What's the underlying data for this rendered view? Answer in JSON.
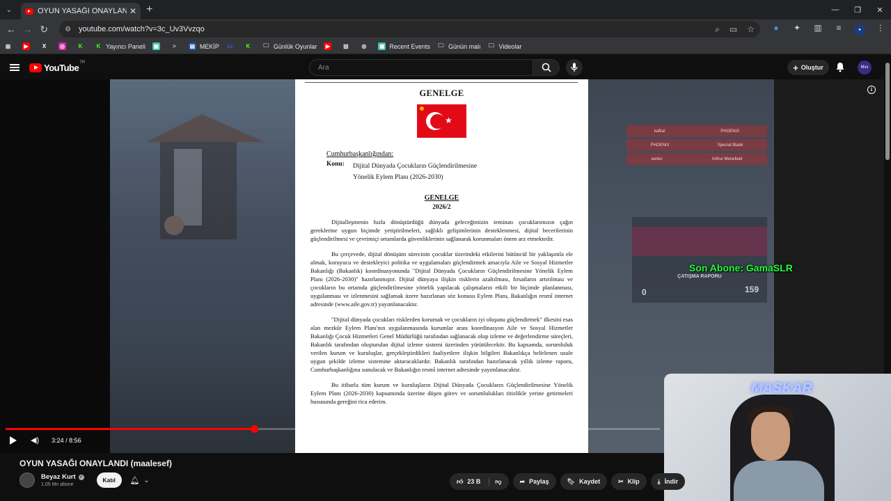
{
  "browser": {
    "tab_title": "OYUN YASAĞI ONAYLANDI (ma…",
    "url": "youtube.com/watch?v=3c_Uv3Vvzqo",
    "bookmarks": [
      "Yayıncı Paneli",
      "MEKİP",
      "Günlük Oyunlar",
      "Recent Events",
      "Günün malı",
      "Videolar"
    ]
  },
  "youtube": {
    "logo_text": "YouTube",
    "country": "TR",
    "search_placeholder": "Ara",
    "create_label": "Oluştur",
    "channel_avatar_text": "Mxx"
  },
  "player": {
    "time": "3:24 / 8:56",
    "progress": 0.38,
    "overlay_text": "Son Abone: GamaSLR",
    "webcam_label": "MASKAR",
    "report_title": "ÇATIŞMA RAPORU",
    "report_left": "0",
    "report_right": "159",
    "killfeed": [
      [
        "kafka!",
        "PHOENIX"
      ],
      [
        "PHOENIX",
        "Special Blade"
      ],
      [
        "senko",
        "Arthur Menefield"
      ]
    ]
  },
  "document": {
    "heading": "GENELGE",
    "from": "Cumhurbaşkanlığından:",
    "konu_label": "Konu:",
    "konu_line1": "Dijital Dünyada Çocukların Güçlendirilmesine",
    "konu_line2": "Yönelik Eylem Planı (2026-2030)",
    "heading2": "GENELGE",
    "number": "2026/2",
    "paragraphs": [
      "Dijitalleşmenin hızla dönüştürdüğü dünyada geleceğimizin teminatı çocuklarımızın çağın gereklerine uygun biçimde yetiştirilmeleri, sağlıklı gelişimlerinin desteklenmesi, dijital becerilerinin güçlendirilmesi ve çevrimiçi ortamlarda güvenliklerinin sağlanarak korunmaları önem arz etmektedir.",
      "Bu çerçevede, dijital dönüşüm sürecinin çocuklar üzerindeki etkilerini bütüncül bir yaklaşımla ele almak, koruyucu ve destekleyici politika ve uygulamaları güçlendirmek amacıyla Aile ve Sosyal Hizmetler Bakanlığı (Bakanlık) koordinasyonunda \"Dijital Dünyada Çocukların Güçlendirilmesine Yönelik Eylem Planı (2026-2030)\" hazırlanmıştır. Dijital dünyaya ilişkin risklerin azaltılması, fırsatların artırılması ve çocukların bu ortamda güçlendirilmesine yönelik yapılacak çalışmaların etkili bir biçimde planlanması, uygulanması ve izlenmesini sağlamak üzere hazırlanan söz konusu Eylem Planı, Bakanlığın resmî internet adresinde (www.aile.gov.tr) yayımlanacaktır.",
      "\"Dijital dünyada çocukları risklerden korumak ve çocukların iyi oluşunu güçlendirmek\" ilkesini esas alan mezkûr Eylem Planı'nın uygulanmasında kurumlar arası koordinasyon Aile ve Sosyal Hizmetler Bakanlığı Çocuk Hizmetleri Genel Müdürlüğü tarafından sağlanacak olup izleme ve değerlendirme süreçleri, Bakanlık tarafından oluşturulan dijital izleme sistemi üzerinden yürütülecektir. Bu kapsamda, sorumluluk verilen kurum ve kuruluşlar, gerçekleştirdikleri faaliyetlere ilişkin bilgileri Bakanlıkça belirlenen usule uygun şekilde izleme sistemine aktaracaklardır. Bakanlık tarafından hazırlanacak yıllık izleme raporu, Cumhurbaşkanlığına sunulacak ve Bakanlığın resmî internet adresinde yayımlanacaktır.",
      "Bu itibarla tüm kurum ve kuruluşların Dijital Dünyada Çocukların Güçlendirilmesine Yönelik Eylem Planı (2026-2030) kapsamında üzerine düşen görev ve sorumlulukları titizlikle yerine getirmeleri hususunda gereğini rica ederim."
    ]
  },
  "video": {
    "title": "OYUN YASAĞI ONAYLANDI (maalesef)",
    "channel": "Beyaz Kurt",
    "subscribers": "1,05 Mn abone",
    "join_label": "Katıl",
    "likes": "23 B",
    "share_label": "Paylaş",
    "save_label": "Kaydet",
    "clip_label": "Klip",
    "download_label": "İndir"
  }
}
